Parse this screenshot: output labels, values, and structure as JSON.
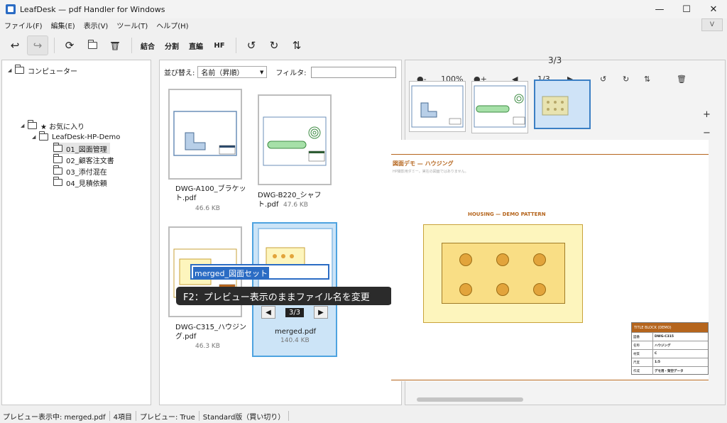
{
  "window": {
    "title": "LeafDesk — pdf Handler for Windows",
    "minimize": "—",
    "maximize": "☐",
    "close": "✕"
  },
  "menu": {
    "items": [
      "ファイル(F)",
      "編集(E)",
      "表示(V)",
      "ツール(T)",
      "ヘルプ(H)"
    ],
    "collapse": "V"
  },
  "toolbar": {
    "undo": "↩",
    "redo": "↪",
    "reload": "⟳",
    "folder": "▭",
    "delete": "🗑",
    "merge": "結合",
    "split": "分割",
    "stamp": "直編",
    "hf": "HF",
    "rotate_left": "↺",
    "rotate_right": "↻",
    "swap": "⇅"
  },
  "tree": {
    "root": "コンピューター",
    "favorites": "★ お気に入り",
    "project": "LeafDesk-HP-Demo",
    "folders": [
      "01_図面管理",
      "02_顧客注文書",
      "03_添付混在",
      "04_見積依頼"
    ]
  },
  "list": {
    "sort_label": "並び替え:",
    "sort_value": "名前（昇順）",
    "filter_label": "フィルタ:",
    "files": [
      {
        "name": "DWG-A100_ブラケット.pdf",
        "size": "46.6 KB"
      },
      {
        "name": "DWG-B220_シャフト.pdf",
        "size": "47.6 KB"
      },
      {
        "name": "DWG-C315_ハウジング.pdf",
        "size": "46.3 KB"
      },
      {
        "name": "merged.pdf",
        "size": "140.4 KB"
      }
    ],
    "rename_value": "merged_図面セット",
    "tooltip": "F2：プレビュー表示のままファイル名を変更",
    "pager": "3/3"
  },
  "preview": {
    "page_badge": "3/3",
    "zoom": "100%",
    "page": "1/3",
    "doc_title": "図面デモ — ハウジング",
    "doc_subtitle": "HP撮影用ダミー。実在の図面ではありません。",
    "caption": "HOUSING — DEMO PATTERN",
    "title_block": {
      "head": "TITLE BLOCK (DEMO)",
      "rows": [
        {
          "k": "図番",
          "v": "DWG-C315"
        },
        {
          "k": "名称",
          "v": "ハウジング"
        },
        {
          "k": "材質",
          "v": "C"
        },
        {
          "k": "尺度",
          "v": "1:5"
        },
        {
          "k": "作成",
          "v": "デモ用・架空データ"
        }
      ]
    },
    "zoom_in": "+",
    "zoom_out": "−"
  },
  "status": {
    "preview": "プレビュー表示中: merged.pdf",
    "count": "4項目",
    "preview_flag": "プレビュー: True",
    "edition": "Standard版（買い切り）"
  },
  "colors": {
    "accent": "#2b6cc4",
    "select_bg": "#cce4f7",
    "drawing_brown": "#b5651d",
    "housing_yellow": "#f9de85"
  }
}
